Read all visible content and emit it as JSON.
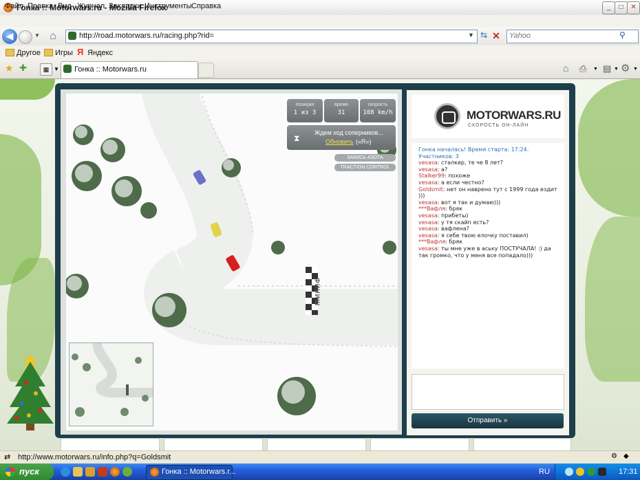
{
  "window": {
    "title": "Гонка :: Motorwars.ru - Mozilla Firefox",
    "min": "_",
    "max": "□",
    "close": "✕"
  },
  "menu": [
    "Файл",
    "Правка",
    "Вид",
    "Журнал",
    "Закладки",
    "Инструменты",
    "Справка"
  ],
  "nav": {
    "url": "http://road.motorwars.ru/racing.php?rid=",
    "search_placeholder": "Yahoo"
  },
  "bookmarks": [
    "Другое",
    "Игры",
    "Яндекс"
  ],
  "tab": {
    "label": "Гонка :: Motorwars.ru"
  },
  "hud": {
    "position_label": "позиция",
    "position_value": "1 из 3",
    "time_label": "время",
    "time_value": "31",
    "speed_label": "скорость",
    "speed_value": "108 km/h",
    "wait_text": "Ждем ход соперников...",
    "refresh_link": "Обновить",
    "refresh_hint": "(«R»)",
    "nitro_button": "ЗАКИСЬ АЗОТА",
    "traction_button": "TRACTION CONTROL",
    "finish_label": "ФИНИШ"
  },
  "logo": {
    "brand": "MOTORWARS.RU",
    "tagline": "СКОРОСТЬ ОН-ЛАЙН"
  },
  "chat": {
    "system": "Гонка началась! Время старта: 17:24. Участников: 3",
    "messages": [
      {
        "nick": "vesasa",
        "text": "сталкер, те че 8 лет?"
      },
      {
        "nick": "vesasa",
        "text": "а?"
      },
      {
        "nick": "Stalker99",
        "text": "похоже"
      },
      {
        "nick": "vesasa",
        "text": "а если честно?"
      },
      {
        "nick": "Goldsmit",
        "text": "нет он наврено тут с 1999 года ездит )))"
      },
      {
        "nick": "vesasa",
        "text": "вот я так и думаю)))"
      },
      {
        "nick": "***Вафля",
        "text": "бряк"
      },
      {
        "nick": "vesasa",
        "text": "прибеты)"
      },
      {
        "nick": "vesasa",
        "text": "у тя скайп есть?"
      },
      {
        "nick": "vesasa",
        "text": "вафлена?"
      },
      {
        "nick": "vesasa",
        "text": "я себе твою елочку поставил)"
      },
      {
        "nick": "***Вафля",
        "text": "бряк"
      },
      {
        "nick": "vesasa",
        "text": "ты мне уже в аську ПОСТУЧАЛА! :) да так громко, что у меня все попадало)))"
      }
    ],
    "send_button": "Отправить »"
  },
  "status": {
    "text": "http://www.motorwars.ru/info.php?q=Goldsmit"
  },
  "taskbar": {
    "start": "пуск",
    "window_label": "Гонка :: Motorwars.r...",
    "lang": "RU",
    "clock": "17:31"
  },
  "colors": {
    "frame": "#1E3E4A",
    "accent_green": "#7FB548",
    "chat_nick": "#B33333",
    "chat_system": "#2E6FB0"
  }
}
